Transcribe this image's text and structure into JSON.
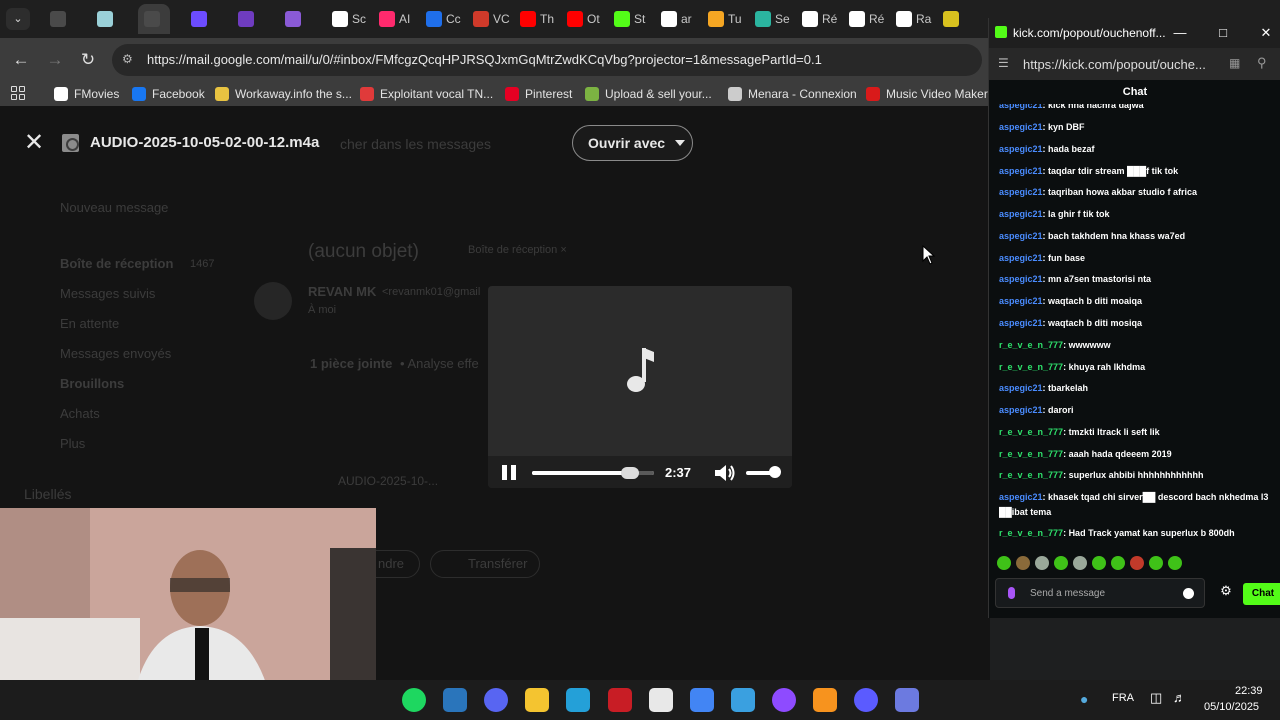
{
  "browser": {
    "tabs": [
      {
        "label": "",
        "color": "#4a4a4a"
      },
      {
        "label": "",
        "color": "#9ad0d8"
      },
      {
        "label": "",
        "color": "#4a4a4a",
        "active": true
      },
      {
        "label": "",
        "color": "#6c4cff"
      },
      {
        "label": "",
        "color": "#6f3cc0"
      },
      {
        "label": "",
        "color": "#8a5ad6"
      },
      {
        "label": "Sc",
        "color": "#ffffff"
      },
      {
        "label": "AI",
        "color": "#ff2a6d"
      },
      {
        "label": "Cc",
        "color": "#1f6feb"
      },
      {
        "label": "VC",
        "color": "#cf3a2a"
      },
      {
        "label": "Th",
        "color": "#ff0000"
      },
      {
        "label": "Ot",
        "color": "#ff0000"
      },
      {
        "label": "St",
        "color": "#53fc18"
      },
      {
        "label": "ar",
        "color": "#ffffff"
      },
      {
        "label": "Tu",
        "color": "#f5a623"
      },
      {
        "label": "Se",
        "color": "#2bb5a0"
      },
      {
        "label": "Ré",
        "color": "#ffffff"
      },
      {
        "label": "Ré",
        "color": "#ffffff"
      },
      {
        "label": "Ra",
        "color": "#ffffff"
      },
      {
        "label": "",
        "color": "#d9c21f"
      }
    ],
    "url": "https://mail.google.com/mail/u/0/#inbox/FMfcgzQcqHPJRSQJxmGqMtrZwdKCqVbg?projector=1&messagePartId=0.1",
    "bookmarks": [
      {
        "label": "FMovies",
        "color": "#ffffff"
      },
      {
        "label": "Facebook",
        "color": "#1877f2"
      },
      {
        "label": "Workaway.info the s...",
        "color": "#e8c341"
      },
      {
        "label": "Exploitant vocal TN...",
        "color": "#e03a3a"
      },
      {
        "label": "Pinterest",
        "color": "#e60023"
      },
      {
        "label": "Upload & sell your...",
        "color": "#7cb342"
      },
      {
        "label": "Menara - Connexion",
        "color": "#cccccc"
      },
      {
        "label": "Music Video Maker",
        "color": "#d91a1a"
      }
    ]
  },
  "preview": {
    "file_name": "AUDIO-2025-10-05-02-00-12.m4a",
    "open_with": "Ouvrir avec",
    "time": "2:37",
    "progress": 0.8,
    "volume": 0.9
  },
  "gmail_bg": {
    "search_placeholder": "cher dans les messages",
    "compose": "Nouveau message",
    "nav": [
      "Boîte de réception",
      "Messages suivis",
      "En attente",
      "Messages envoyés",
      "Brouillons",
      "Achats",
      "Plus"
    ],
    "inbox_count": "1467",
    "labels": "Libellés",
    "subject": "(aucun objet)",
    "subject_tag": "Boîte de réception ×",
    "sender": "REVAN MK",
    "sender_email": "<revanmk01@gmail",
    "to": "À moi",
    "attachment": "1 pièce jointe",
    "scan": "• Analyse effe",
    "attachment_name": "AUDIO-2025-10-...",
    "reply": "ndre",
    "forward": "Transférer"
  },
  "chat": {
    "window_title": "kick.com/popout/ouchenoff...",
    "url": "https://kick.com/popout/ouche...",
    "header": "Chat",
    "username_colors": {
      "aspegic21": "#4a8cff",
      "r_e_v_e_n_777": "#2ee06b"
    },
    "messages": [
      {
        "user": "aspegic21",
        "text": "kick hna nachra dajwa"
      },
      {
        "user": "aspegic21",
        "text": "kyn DBF"
      },
      {
        "user": "aspegic21",
        "text": "hada bezaf"
      },
      {
        "user": "aspegic21",
        "text": "taqdar tdir stream ███f tik tok"
      },
      {
        "user": "aspegic21",
        "text": "taqriban howa akbar studio f africa"
      },
      {
        "user": "aspegic21",
        "text": "la ghir f tik tok"
      },
      {
        "user": "aspegic21",
        "text": "bach takhdem hna khass wa7ed"
      },
      {
        "user": "aspegic21",
        "text": "fun base"
      },
      {
        "user": "aspegic21",
        "text": "mn a7sen tmastorisi nta"
      },
      {
        "user": "aspegic21",
        "text": "waqtach b diti moaiqa"
      },
      {
        "user": "aspegic21",
        "text": "waqtach b diti mosiqa"
      },
      {
        "user": "r_e_v_e_n_777",
        "text": "wwwwww"
      },
      {
        "user": "r_e_v_e_n_777",
        "text": "khuya rah lkhdma"
      },
      {
        "user": "aspegic21",
        "text": "tbarkelah"
      },
      {
        "user": "aspegic21",
        "text": "darori"
      },
      {
        "user": "r_e_v_e_n_777",
        "text": "tmzkti ltrack li seft lik"
      },
      {
        "user": "r_e_v_e_n_777",
        "text": "aaah hada qdeeem 2019"
      },
      {
        "user": "r_e_v_e_n_777",
        "text": "superlux ahbibi hhhhhhhhhhhh"
      },
      {
        "user": "aspegic21",
        "text": "khasek tqad chi sirver██ descord bach nkhedma l3 ██ibat tema"
      },
      {
        "user": "r_e_v_e_n_777",
        "text": "Had Track yamat kan superlux b 800dh"
      }
    ],
    "input_placeholder": "Send a message",
    "send": "Chat"
  },
  "taskbar": {
    "apps": [
      {
        "name": "spotify-icon",
        "color": "#1ed760"
      },
      {
        "name": "steam-icon",
        "color": "#2a75bb"
      },
      {
        "name": "discord-icon",
        "color": "#5865f2"
      },
      {
        "name": "explorer-icon",
        "color": "#f4c430"
      },
      {
        "name": "monitor-icon",
        "color": "#24a0d8"
      },
      {
        "name": "app-red-icon",
        "color": "#c81d25"
      },
      {
        "name": "app-recorder-icon",
        "color": "#e8e8e8"
      },
      {
        "name": "chrome-icon",
        "color": "#4285f4"
      },
      {
        "name": "vscode-icon",
        "color": "#3aa0e0"
      },
      {
        "name": "affinity-icon",
        "color": "#8e4bff"
      },
      {
        "name": "fl-studio-icon",
        "color": "#f7931e"
      },
      {
        "name": "cortana-icon",
        "color": "#5b5bff"
      },
      {
        "name": "calculator-icon",
        "color": "#6c7ae0"
      }
    ],
    "lang": "FRA",
    "time": "22:39",
    "date": "05/10/2025"
  }
}
